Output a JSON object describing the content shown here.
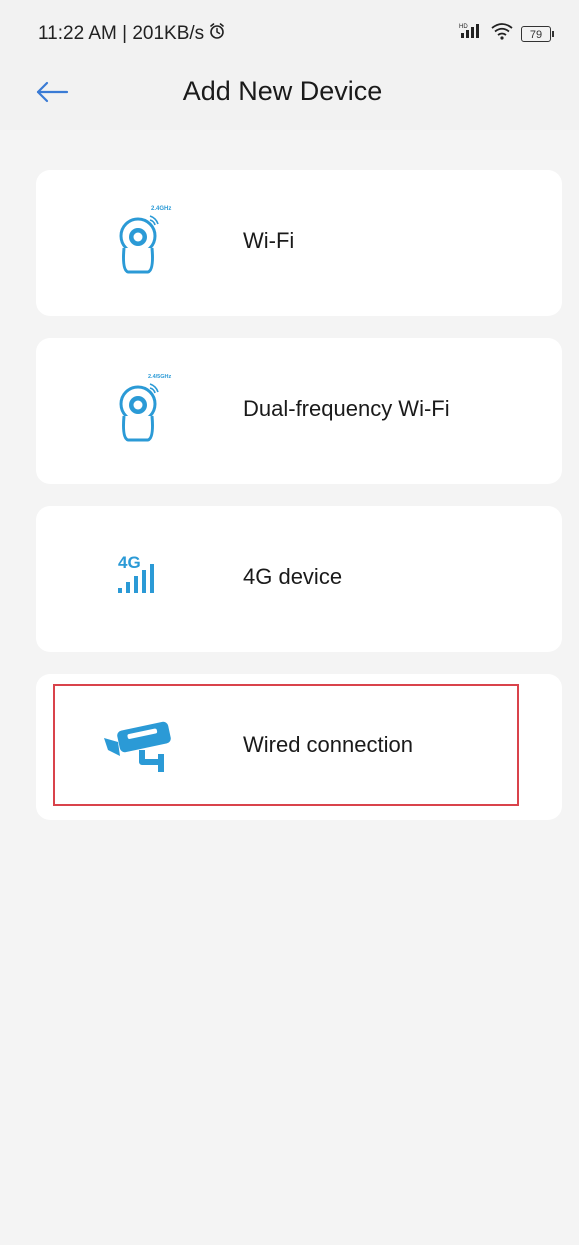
{
  "status_bar": {
    "time_speed": "11:22 AM | 201KB/s",
    "battery": "79",
    "icons": [
      "alarm-icon",
      "signal-icon",
      "wifi-icon",
      "battery-icon"
    ]
  },
  "header": {
    "title": "Add New Device",
    "back_icon": "back-arrow-icon"
  },
  "options": [
    {
      "label": "Wi-Fi",
      "icon": "wifi-camera-icon",
      "band": "2.4GHz"
    },
    {
      "label": "Dual-frequency Wi-Fi",
      "icon": "dual-wifi-camera-icon",
      "band": "2.4/5GHz"
    },
    {
      "label": "4G device",
      "icon": "4g-signal-icon",
      "badge": "4G"
    },
    {
      "label": "Wired connection",
      "icon": "bullet-camera-icon",
      "highlighted": true
    }
  ],
  "colors": {
    "accent": "#2b9ad6",
    "highlight_border": "#d9434b",
    "back_arrow": "#3a7bd5"
  }
}
